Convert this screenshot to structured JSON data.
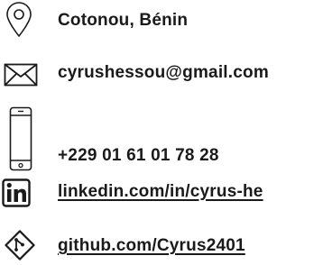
{
  "contact": {
    "location": {
      "icon": "map-pin-icon",
      "text": "Cotonou, Bénin"
    },
    "email": {
      "icon": "envelope-icon",
      "text": "cyrushessou@gmail.com"
    },
    "phone": {
      "icon": "smartphone-icon",
      "text": "+229 01 61 01 78 28"
    },
    "linkedin": {
      "icon": "linkedin-icon",
      "text": "linkedin.com/in/cyrus-he"
    },
    "github": {
      "icon": "git-branch-icon",
      "text": "github.com/Cyrus2401"
    }
  },
  "colors": {
    "text": "#1a1a1a",
    "background": "#ffffff"
  }
}
